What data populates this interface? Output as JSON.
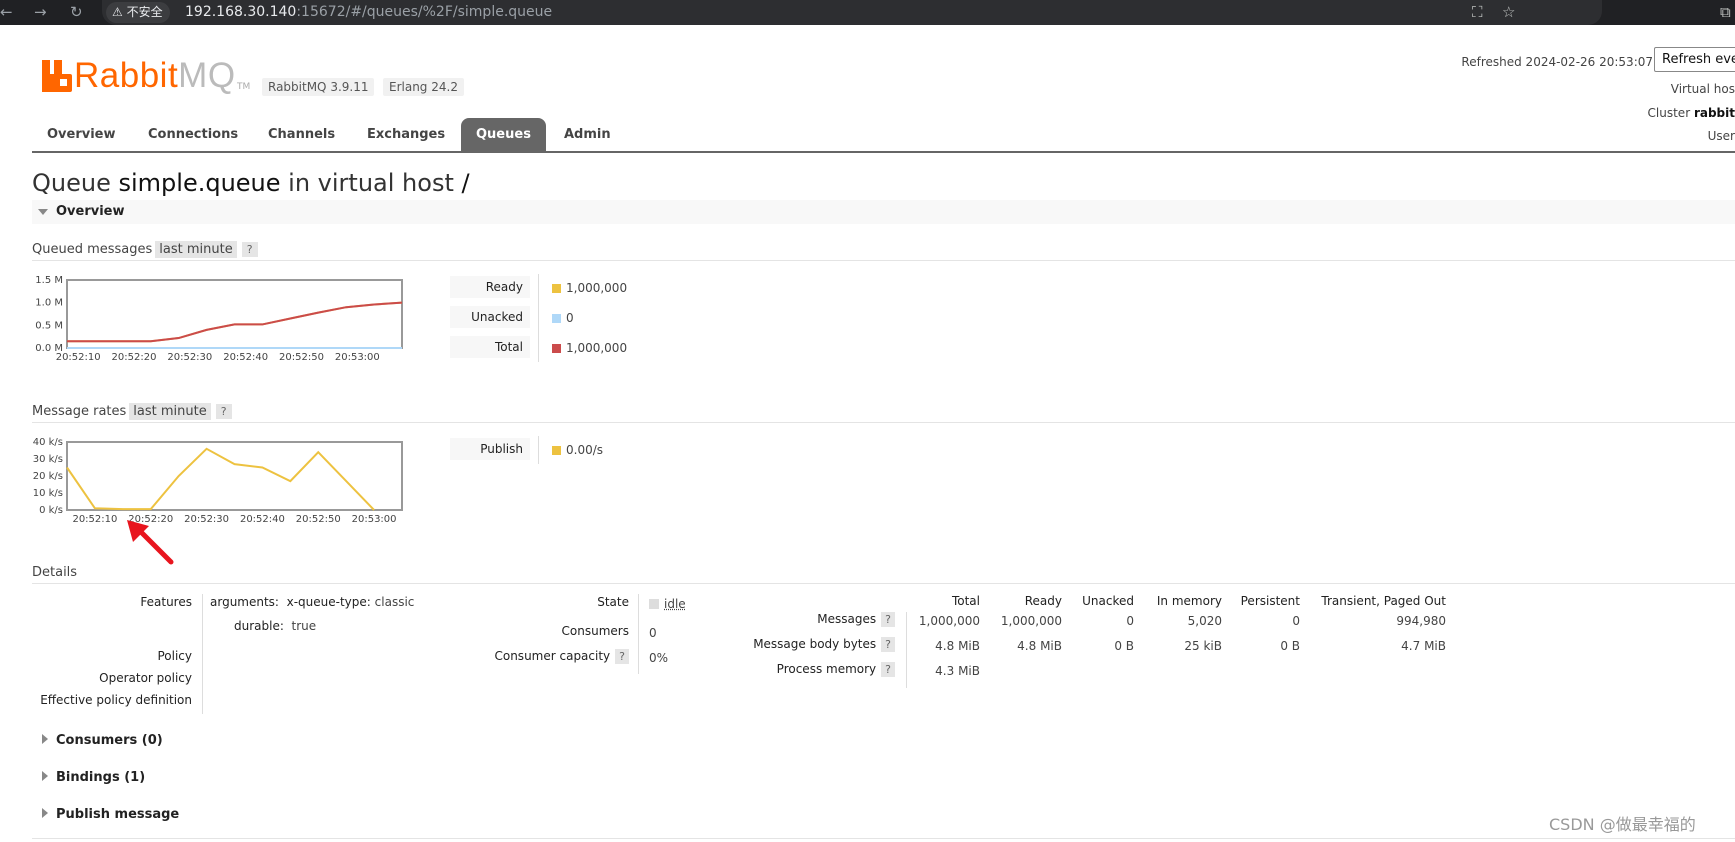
{
  "browser": {
    "insecure_label": "不安全",
    "url_host": "192.168.30.140",
    "url_rest": ":15672/#/queues/%2F/simple.queue"
  },
  "header": {
    "logo_rabbit": "Rabbit",
    "logo_mq": "MQ",
    "logo_tm": "TM",
    "rabbitmq_version": "RabbitMQ 3.9.11",
    "erlang_version": "Erlang 24.2",
    "refreshed": "Refreshed 2024-02-26 20:53:07",
    "refresh_select": "Refresh eve",
    "virtual_host_label": "Virtual hos",
    "cluster_label": "Cluster",
    "cluster_value": "rabbit",
    "user_label": "User"
  },
  "tabs": [
    {
      "label": "Overview"
    },
    {
      "label": "Connections"
    },
    {
      "label": "Channels"
    },
    {
      "label": "Exchanges"
    },
    {
      "label": "Queues",
      "active": true
    },
    {
      "label": "Admin"
    }
  ],
  "title": {
    "prefix": "Queue",
    "queue_name": "simple.queue",
    "middle": "in virtual host",
    "vhost": "/"
  },
  "overview_section": {
    "title": "Overview"
  },
  "queued_messages": {
    "heading": "Queued messages",
    "range": "last minute",
    "help": "?",
    "legend": [
      {
        "label": "Ready",
        "value": "1,000,000",
        "color": "#edc240"
      },
      {
        "label": "Unacked",
        "value": "0",
        "color": "#afd8f8"
      },
      {
        "label": "Total",
        "value": "1,000,000",
        "color": "#cb4b4b"
      }
    ]
  },
  "message_rates": {
    "heading": "Message rates",
    "range": "last minute",
    "help": "?",
    "legend": [
      {
        "label": "Publish",
        "value": "0.00/s",
        "color": "#edc240"
      }
    ]
  },
  "chart_data": [
    {
      "type": "line",
      "title": "Queued messages",
      "x": [
        "20:52:08",
        "20:52:13",
        "20:52:18",
        "20:52:23",
        "20:52:28",
        "20:52:33",
        "20:52:38",
        "20:52:43",
        "20:52:48",
        "20:52:53",
        "20:52:58",
        "20:53:03",
        "20:53:08"
      ],
      "x_ticks": [
        "20:52:10",
        "20:52:20",
        "20:52:30",
        "20:52:40",
        "20:52:50",
        "20:53:00"
      ],
      "y_ticks": [
        "1.5 M",
        "1.0 M",
        "0.5 M",
        "0.0 M"
      ],
      "ylim": [
        0,
        1500000
      ],
      "series": [
        {
          "name": "Total",
          "color": "#cb4b4b",
          "values": [
            150000,
            150000,
            150000,
            150000,
            220000,
            400000,
            520000,
            520000,
            650000,
            780000,
            900000,
            960000,
            1000000
          ]
        },
        {
          "name": "Ready",
          "color": "#edc240",
          "values": [
            150000,
            150000,
            150000,
            150000,
            220000,
            400000,
            520000,
            520000,
            650000,
            780000,
            900000,
            960000,
            1000000
          ]
        },
        {
          "name": "Unacked",
          "color": "#afd8f8",
          "values": [
            0,
            0,
            0,
            0,
            0,
            0,
            0,
            0,
            0,
            0,
            0,
            0,
            0
          ]
        }
      ]
    },
    {
      "type": "line",
      "title": "Message rates",
      "x": [
        "20:52:05",
        "20:52:10",
        "20:52:15",
        "20:52:20",
        "20:52:25",
        "20:52:30",
        "20:52:35",
        "20:52:40",
        "20:52:45",
        "20:52:50",
        "20:52:55",
        "20:53:00"
      ],
      "x_ticks": [
        "20:52:10",
        "20:52:20",
        "20:52:30",
        "20:52:40",
        "20:52:50",
        "20:53:00"
      ],
      "y_ticks": [
        "40 k/s",
        "30 k/s",
        "20 k/s",
        "10 k/s",
        "0 k/s"
      ],
      "ylim": [
        0,
        40000
      ],
      "series": [
        {
          "name": "Publish",
          "color": "#edc240",
          "values": [
            25000,
            1000,
            500,
            500,
            20000,
            36000,
            27000,
            25000,
            17000,
            34000,
            17000,
            0
          ]
        }
      ]
    }
  ],
  "details": {
    "heading": "Details",
    "features_label": "Features",
    "arg_key": "arguments:",
    "arg_name": "x-queue-type:",
    "arg_value": "classic",
    "durable_key": "durable:",
    "durable_value": "true",
    "policy_label": "Policy",
    "operator_policy_label": "Operator policy",
    "effective_policy_label": "Effective policy definition",
    "state_label": "State",
    "state_value": "idle",
    "consumers_label": "Consumers",
    "consumers_value": "0",
    "capacity_label": "Consumer capacity",
    "capacity_value": "0%",
    "help": "?",
    "columns": [
      "Total",
      "Ready",
      "Unacked",
      "In memory",
      "Persistent",
      "Transient, Paged Out"
    ],
    "rows": [
      {
        "label": "Messages",
        "values": [
          "1,000,000",
          "1,000,000",
          "0",
          "5,020",
          "0",
          "994,980"
        ]
      },
      {
        "label": "Message body bytes",
        "values": [
          "4.8 MiB",
          "4.8 MiB",
          "0 B",
          "25 kiB",
          "0 B",
          "4.7 MiB"
        ]
      },
      {
        "label": "Process memory",
        "values": [
          "4.3 MiB",
          "",
          "",
          "",
          "",
          ""
        ]
      }
    ]
  },
  "collapsed_sections": [
    {
      "title": "Consumers (0)"
    },
    {
      "title": "Bindings (1)"
    },
    {
      "title": "Publish message"
    }
  ],
  "watermark": "CSDN @做最幸福的"
}
